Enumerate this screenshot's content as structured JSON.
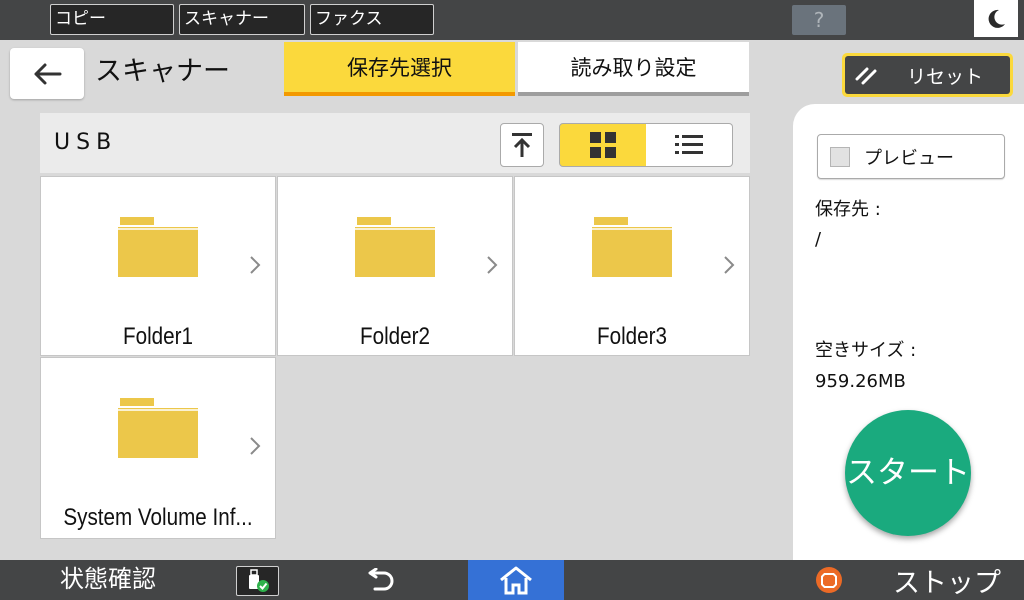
{
  "top_bar": {
    "app_tabs": [
      {
        "label": "コピー"
      },
      {
        "label": "スキャナー"
      },
      {
        "label": "ファクス"
      }
    ],
    "help_label": "?",
    "help_icon": "question-mark-icon",
    "sleep_icon": "crescent-moon-icon"
  },
  "header": {
    "back_icon": "arrow-left-icon",
    "title": "スキャナー",
    "tabs": [
      {
        "label": "保存先選択",
        "active": true
      },
      {
        "label": "読み取り設定",
        "active": false
      }
    ],
    "reset_label": "リセット",
    "reset_icon": "double-slash-icon"
  },
  "file_browser": {
    "current_path": "USB",
    "up_icon": "upload-arrow-icon",
    "view_modes": [
      {
        "name": "grid",
        "icon": "grid-icon",
        "active": true
      },
      {
        "name": "list",
        "icon": "list-icon",
        "active": false
      }
    ],
    "folders": [
      {
        "name": "Folder1"
      },
      {
        "name": "Folder2"
      },
      {
        "name": "Folder3"
      },
      {
        "name": "System Volume Inf..."
      }
    ],
    "folder_color": "#ecc74a"
  },
  "side_panel": {
    "preview_label": "プレビュー",
    "preview_checked": false,
    "destination_label": "保存先 :",
    "destination_value": "/",
    "free_space_label": "空きサイズ :",
    "free_space_value": "959.26MB",
    "start_label": "スタート"
  },
  "bottom_bar": {
    "status_label": "状態確認",
    "usb_icon": "usb-check-icon",
    "undo_icon": "undo-arrow-icon",
    "home_icon": "home-icon",
    "stop_icon": "stop-icon",
    "stop_label": "ストップ"
  },
  "colors": {
    "accent_yellow": "#fbd93c",
    "accent_orange": "#f39900",
    "start_green": "#1aaa7e",
    "home_blue": "#3571d6",
    "bar_dark": "#444546"
  }
}
